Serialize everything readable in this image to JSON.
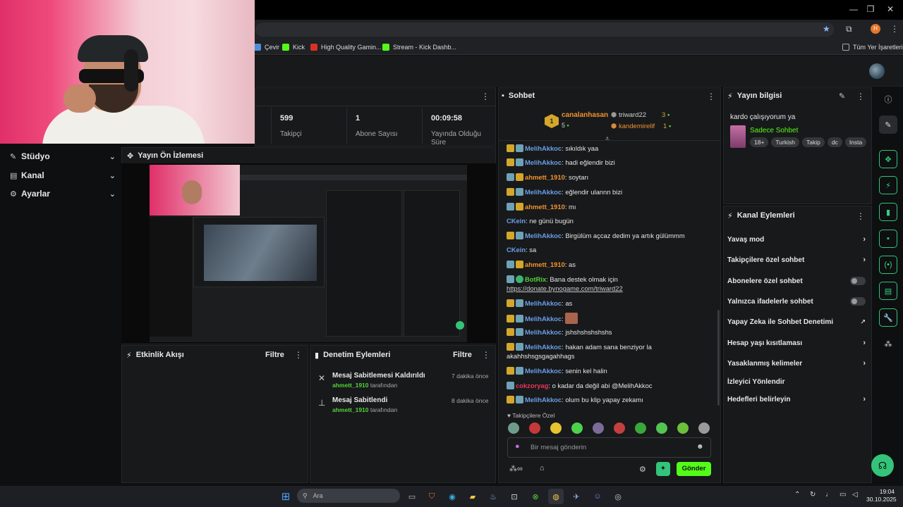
{
  "browser": {
    "bookmarks": [
      {
        "label": "Çevir",
        "color": "#4a90d9"
      },
      {
        "label": "Kick",
        "color": "#53fc18"
      },
      {
        "label": "High Quality Gamin...",
        "color": "#d93025"
      },
      {
        "label": "Stream - Kick Dashb...",
        "color": "#53fc18"
      }
    ],
    "all_bookmarks": "Tüm Yer İşaretleri",
    "profile_initial": "H"
  },
  "leftnav": {
    "items": [
      {
        "label": "Stüdyo"
      },
      {
        "label": "Kanal"
      },
      {
        "label": "Ayarlar"
      }
    ]
  },
  "stats": [
    {
      "value": "599",
      "label": "Takipçi"
    },
    {
      "value": "1",
      "label": "Abone Sayısı"
    },
    {
      "value": "00:09:58",
      "label": "Yayında Olduğu Süre"
    }
  ],
  "preview": {
    "title": "Yayın Ön İzlemesi"
  },
  "activity": {
    "title": "Etkinlik Akışı",
    "filter": "Filtre"
  },
  "moderation": {
    "title": "Denetim Eylemleri",
    "filter": "Filtre",
    "items": [
      {
        "action": "Mesaj Sabitlemesi Kaldırıldı",
        "user": "ahmett_1910",
        "by": "tarafından",
        "time": "7 dakika önce"
      },
      {
        "action": "Mesaj Sabitlendi",
        "user": "ahmett_1910",
        "by": "tarafından",
        "time": "8 dakika önce"
      }
    ]
  },
  "chat": {
    "title": "Sohbet",
    "leaderboard": {
      "rank": "1",
      "top_user": "canalanhasan",
      "top_count": "5",
      "others": [
        {
          "user": "triward22",
          "count": "3"
        },
        {
          "user": "kandemirelif",
          "count": "1"
        }
      ]
    },
    "messages": [
      {
        "badges": [
          "crown",
          "sub"
        ],
        "user": "MelihAkkoc",
        "color": "blue",
        "text": ": sıkıldık yaa"
      },
      {
        "badges": [
          "crown",
          "sub"
        ],
        "user": "MelihAkkoc",
        "color": "blue",
        "text": ": hadi eğlendir bizi"
      },
      {
        "badges": [
          "sub",
          "crown"
        ],
        "user": "ahmett_1910",
        "color": "orange",
        "text": ": soytarı"
      },
      {
        "badges": [
          "crown",
          "sub"
        ],
        "user": "MelihAkkoc",
        "color": "blue",
        "text": ": eğlendir ulannn bizi"
      },
      {
        "badges": [
          "sub",
          "crown"
        ],
        "user": "ahmett_1910",
        "color": "orange",
        "text": ": mı"
      },
      {
        "badges": [],
        "user": "CKein",
        "color": "blue",
        "text": ": ne günü bugün"
      },
      {
        "badges": [
          "crown",
          "sub"
        ],
        "user": "MelihAkkoc",
        "color": "blue",
        "text": ": Birgülüm açcaz dedim ya artık gülümmm"
      },
      {
        "badges": [],
        "user": "CKein",
        "color": "blue",
        "text": ": sa"
      },
      {
        "badges": [
          "sub",
          "crown"
        ],
        "user": "ahmett_1910",
        "color": "orange",
        "text": ": as"
      },
      {
        "badges": [
          "sub",
          "ver"
        ],
        "user": "BotRix",
        "color": "green",
        "text": ": Bana destek olmak için"
      },
      {
        "badges": [
          "crown",
          "sub"
        ],
        "user": "MelihAkkoc",
        "color": "blue",
        "text": ": as"
      },
      {
        "badges": [
          "crown",
          "sub"
        ],
        "user": "MelihAkkoc",
        "color": "blue",
        "text": ":"
      },
      {
        "badges": [
          "crown",
          "sub"
        ],
        "user": "MelihAkkoc",
        "color": "blue",
        "text": ": jshshshshshshs"
      },
      {
        "badges": [
          "crown",
          "sub"
        ],
        "user": "MelihAkkoc",
        "color": "blue",
        "text": ": hakan adam sana benziyor la"
      },
      {
        "badges": [
          "crown",
          "sub"
        ],
        "user": "MelihAkkoc",
        "color": "blue",
        "text": ": senin kel halin"
      },
      {
        "badges": [
          "sub"
        ],
        "user": "cokzoryag",
        "color": "red",
        "text": ": o kadar da değil abi @MelihAkkoc"
      },
      {
        "badges": [
          "crown",
          "sub"
        ],
        "user": "MelihAkkoc",
        "color": "blue",
        "text": ": olum bu klip yapay zekamı"
      }
    ],
    "botrix_link": "https://donate.bynogame.com/triward22",
    "hakan_cont": "akahhshsgsgagahhags",
    "followers_only": "Takipçilere Özel",
    "input_placeholder": "Bir mesaj gönderin",
    "send": "Gönder"
  },
  "stream_info": {
    "title": "Yayın bilgisi",
    "stream_title": "kardo çalışıyorum ya",
    "category": "Sadece Sohbet",
    "tags": [
      "18+",
      "Turkish",
      "Takip",
      "dc",
      "Insta"
    ]
  },
  "channel_actions": {
    "title": "Kanal Eylemleri",
    "items": [
      {
        "label": "Yavaş mod",
        "control": "arrow"
      },
      {
        "label": "Takipçilere özel sohbet",
        "control": "arrow"
      },
      {
        "label": "Abonelere özel sohbet",
        "control": "toggle"
      },
      {
        "label": "Yalnızca ifadelerle sohbet",
        "control": "toggle"
      },
      {
        "label": "Yapay Zeka ile Sohbet Denetimi",
        "control": "external"
      },
      {
        "label": "Hesap yaşı kısıtlaması",
        "control": "arrow"
      },
      {
        "label": "Yasaklanmış kelimeler",
        "control": "arrow"
      },
      {
        "label": "İzleyici Yönlendir",
        "control": "none"
      },
      {
        "label": "Hedefleri belirleyin",
        "control": "arrow"
      }
    ]
  },
  "taskbar": {
    "search_placeholder": "Ara",
    "time": "19:04",
    "date": "30.10.2025"
  },
  "colors": {
    "accent": "#53fc18",
    "panel": "#18191b",
    "bg": "#0e0f10"
  }
}
